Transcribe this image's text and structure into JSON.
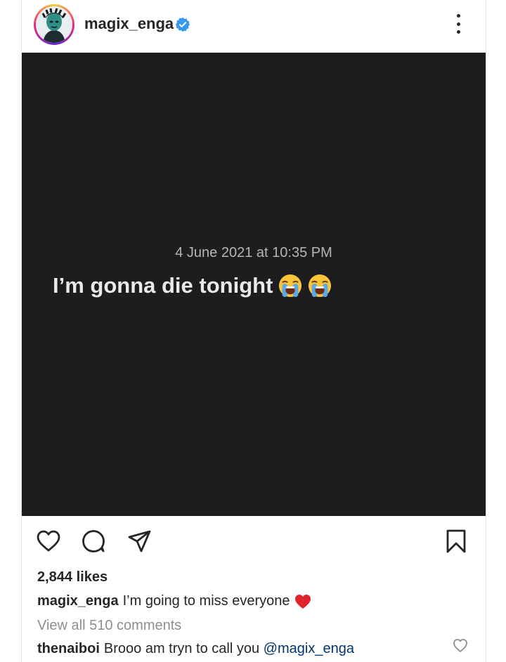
{
  "post": {
    "username": "magix_enga",
    "image": {
      "timestamp": "4 June 2021 at 10:35 PM",
      "text": "I’m gonna die tonight"
    },
    "likes": "2,844 likes",
    "caption": {
      "user": "magix_enga",
      "text": "I’m going to miss everyone"
    },
    "view_comments": "View all 510 comments",
    "comment": {
      "user": "thenaiboi",
      "text": "Brooo am tryn to call you ",
      "mention": "@magix_enga"
    }
  },
  "icons": {
    "verified": "verified-badge-icon",
    "more": "more-options-icon",
    "like": "heart-icon",
    "comment": "comment-icon",
    "share": "share-icon",
    "save": "bookmark-icon",
    "emoji": "loudly-crying-face-emoji",
    "caption_emoji": "red-heart-emoji"
  },
  "colors": {
    "verified": "#3897f0",
    "text": "#262626",
    "muted": "#8e8e8e",
    "mention": "#00376b",
    "heart": "#e0242c",
    "image_bg": "#1c1c1e"
  }
}
